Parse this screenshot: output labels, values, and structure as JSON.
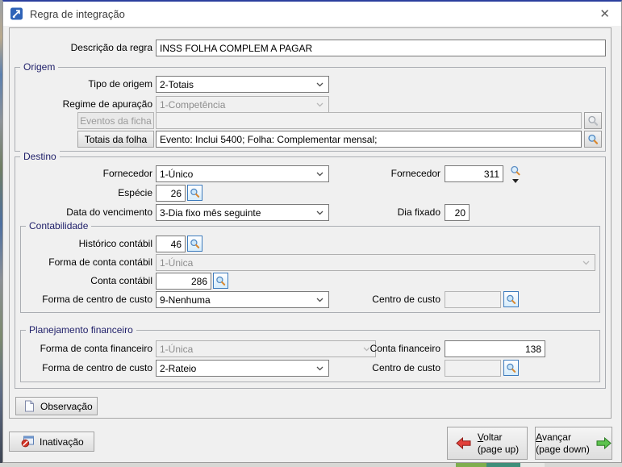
{
  "window": {
    "title": "Regra de integração",
    "close_glyph": "✕"
  },
  "colors": {
    "titlebar_top_border": "#2b3f9e",
    "dialog_background": "#f0f0f0",
    "lookup_button_border": "#3d7bbd",
    "magnifier_handle": "#d9882f",
    "back_arrow": "#e2403a",
    "forward_arrow": "#5cc24e"
  },
  "icons": {
    "app": "integration-arrow-icon",
    "close": "close-icon",
    "lookup": "magnifier-icon",
    "dropdown": "chevron-down-icon",
    "observation": "document-icon",
    "inactivation": "window-prohibition-icon",
    "back": "red-left-arrow-icon",
    "forward": "green-right-arrow-icon"
  },
  "description": {
    "label": "Descrição da regra",
    "value": "INSS FOLHA COMPLEM A PAGAR"
  },
  "origem": {
    "legend": "Origem",
    "tipo": {
      "label": "Tipo de origem",
      "value": "2-Totais"
    },
    "regime": {
      "label": "Regime de apuração",
      "value": "1-Competência"
    },
    "eventos": {
      "button": "Eventos da ficha",
      "value": ""
    },
    "totais": {
      "button": "Totais da folha",
      "value": "Evento: Inclui 5400; Folha: Complementar mensal;"
    }
  },
  "destino": {
    "legend": "Destino",
    "fornecedor": {
      "label": "Fornecedor",
      "value": "1-Único"
    },
    "fornecedor_codigo": {
      "label": "Fornecedor",
      "value": "311"
    },
    "especie": {
      "label": "Espécie",
      "value": "26"
    },
    "vencimento": {
      "label": "Data do vencimento",
      "value": "3-Dia fixo mês seguinte"
    },
    "dia_fixado": {
      "label": "Dia fixado",
      "value": "20"
    },
    "contabilidade": {
      "legend": "Contabilidade",
      "historico": {
        "label": "Histórico contábil",
        "value": "46"
      },
      "forma_conta": {
        "label": "Forma de conta contábil",
        "value": "1-Única"
      },
      "conta": {
        "label": "Conta contábil",
        "value": "286"
      },
      "forma_centro_custo": {
        "label": "Forma de centro de custo",
        "value": "9-Nenhuma"
      },
      "centro_custo": {
        "label": "Centro de custo",
        "value": ""
      }
    },
    "planejamento": {
      "legend": "Planejamento financeiro",
      "forma_conta": {
        "label": "Forma de conta financeiro",
        "value": "1-Única"
      },
      "conta": {
        "label": "Conta financeiro",
        "value": "138"
      },
      "forma_centro_custo": {
        "label": "Forma de centro de custo",
        "value": "2-Rateio"
      },
      "centro_custo": {
        "label": "Centro de custo",
        "value": ""
      }
    }
  },
  "footer": {
    "observacao": "Observação",
    "inativacao": "Inativação",
    "voltar": {
      "label": "Voltar",
      "hint": "(page up)"
    },
    "avancar": {
      "label": "Avançar",
      "hint": "(page down)"
    }
  }
}
